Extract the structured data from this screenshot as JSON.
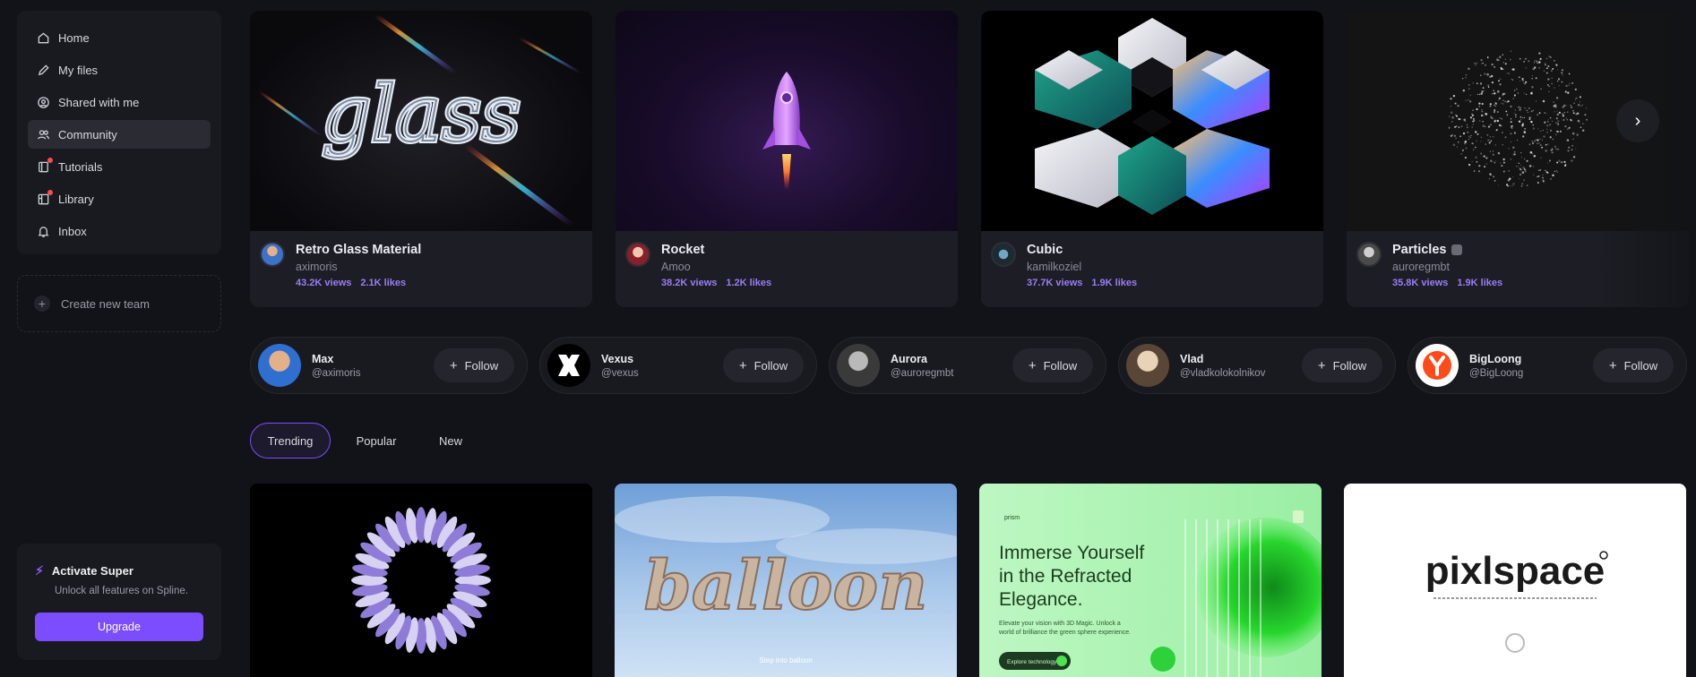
{
  "sidebar": {
    "items": [
      {
        "label": "Home",
        "icon": "home-icon"
      },
      {
        "label": "My files",
        "icon": "pencil-icon"
      },
      {
        "label": "Shared with me",
        "icon": "shared-icon"
      },
      {
        "label": "Community",
        "icon": "users-icon",
        "active": true
      },
      {
        "label": "Tutorials",
        "icon": "book-icon",
        "notification": true
      },
      {
        "label": "Library",
        "icon": "library-icon",
        "notification": true
      },
      {
        "label": "Inbox",
        "icon": "bell-icon"
      }
    ],
    "create_team": "Create new team",
    "super": {
      "title": "Activate Super",
      "subtitle": "Unlock all features on Spline.",
      "button": "Upgrade"
    }
  },
  "featured": [
    {
      "title": "Retro Glass Material",
      "author": "aximoris",
      "views": "43.2K views",
      "likes": "2.1K likes",
      "thumb_text": "glass"
    },
    {
      "title": "Rocket",
      "author": "Amoo",
      "views": "38.2K views",
      "likes": "1.2K likes"
    },
    {
      "title": "Cubic",
      "author": "kamilkoziel",
      "views": "37.7K views",
      "likes": "1.9K likes"
    },
    {
      "title": "Particles",
      "author": "auroregmbt",
      "views": "35.8K views",
      "likes": "1.9K likes"
    }
  ],
  "creators": [
    {
      "name": "Max",
      "handle": "@aximoris",
      "follow": "Follow"
    },
    {
      "name": "Vexus",
      "handle": "@vexus",
      "follow": "Follow"
    },
    {
      "name": "Aurora",
      "handle": "@auroregmbt",
      "follow": "Follow"
    },
    {
      "name": "Vlad",
      "handle": "@vladkolokolnikov",
      "follow": "Follow"
    },
    {
      "name": "BigLoong",
      "handle": "@BigLoong",
      "follow": "Follow"
    }
  ],
  "tabs": [
    "Trending",
    "Popular",
    "New"
  ],
  "active_tab": "Trending",
  "gallery": [
    {
      "thumb_text": ""
    },
    {
      "thumb_text": "balloon",
      "caption": "Step into balloon"
    },
    {
      "headline": "Immerse Yourself in the Refracted Elegance.",
      "body": "Elevate your vision with 3D Magic. Unlock a world of brilliance the green sphere experience.",
      "cta": "Explore technology",
      "brand": "prism"
    },
    {
      "thumb_text": "pixlspace"
    }
  ],
  "colors": {
    "accent": "#7c4dff",
    "stats": "#9b7cf5",
    "background": "#121318"
  }
}
